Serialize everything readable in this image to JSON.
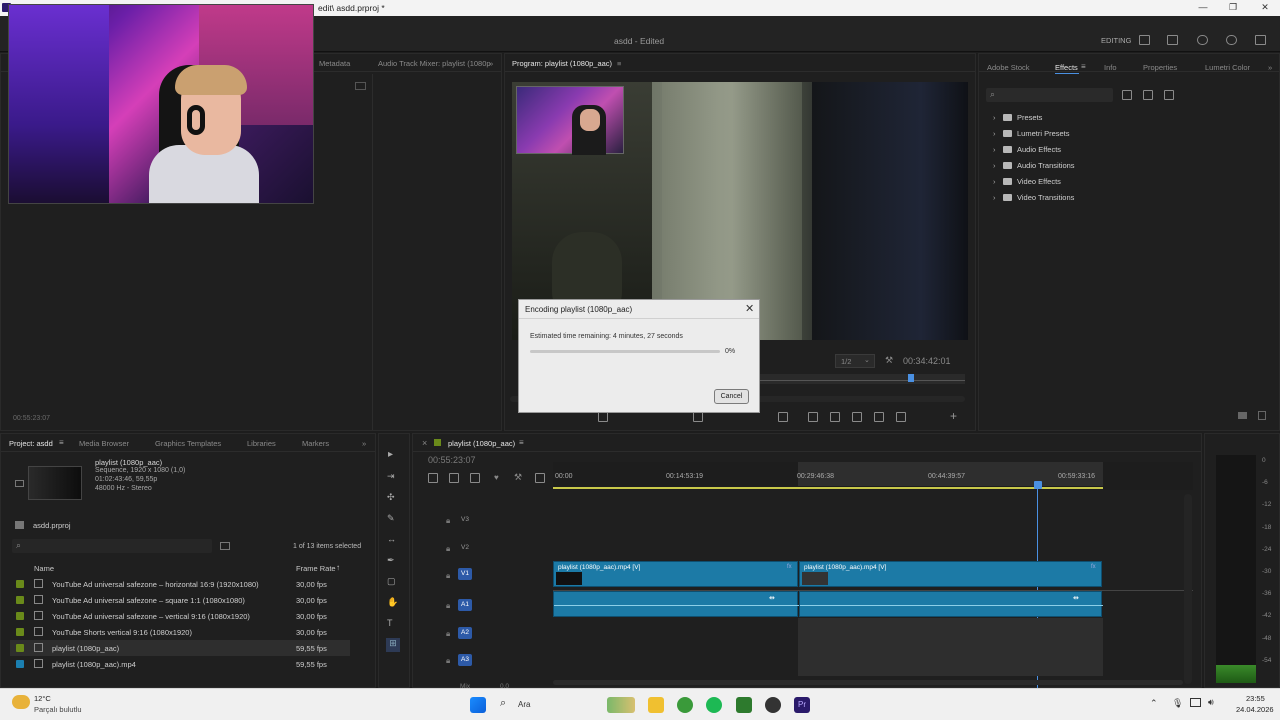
{
  "window": {
    "title": "edit\\ asdd.prproj *",
    "controls": [
      "—",
      "❐",
      "✕"
    ]
  },
  "header": {
    "project_status": "asdd - Edited",
    "mode": "EDITING"
  },
  "source_panel": {
    "tabs": [
      "Metadata",
      "Audio Track Mixer: playlist (1080p",
      "»"
    ],
    "timecode": "00:55:23:07"
  },
  "program": {
    "tab": "Program: playlist (1080p_aac)",
    "tab_menu": "≡",
    "zoom": "1/2",
    "duration": "00:34:42:01"
  },
  "effects_panel": {
    "tabs": [
      "Adobe Stock",
      "Effects",
      "Info",
      "Properties",
      "Lumetri Color",
      "»"
    ],
    "active_tab": "Effects",
    "items": [
      "Presets",
      "Lumetri Presets",
      "Audio Effects",
      "Audio Transitions",
      "Video Effects",
      "Video Transitions"
    ]
  },
  "dialog": {
    "title": "Encoding playlist (1080p_aac)",
    "close": "✕",
    "estimate": "Estimated time remaining: 4 minutes, 27 seconds",
    "progress_pct": 0,
    "progress_label": "0%",
    "cancel": "Cancel"
  },
  "project_panel": {
    "tabs": [
      "Project: asdd",
      "Media Browser",
      "Graphics Templates",
      "Libraries",
      "Markers",
      "»"
    ],
    "seq_name": "playlist (1080p_aac)",
    "seq_info1": "Sequence, 1920 x 1080 (1,0)",
    "seq_info2": "01:02:43:46, 59,55p",
    "seq_info3": "48000 Hz - Stereo",
    "file": "asdd.prproj",
    "selection": "1 of 13 items selected",
    "col_name": "Name",
    "col_rate": "Frame Rate",
    "sort_arrow": "↑",
    "rows": [
      {
        "name": "YouTube Ad universal safezone – horizontal 16:9 (1920x1080)",
        "rate": "30,00 fps",
        "color": "#6a8a1a"
      },
      {
        "name": "YouTube Ad universal safezone – square 1:1 (1080x1080)",
        "rate": "30,00 fps",
        "color": "#6a8a1a"
      },
      {
        "name": "YouTube Ad universal safezone – vertical 9:16 (1080x1920)",
        "rate": "30,00 fps",
        "color": "#6a8a1a"
      },
      {
        "name": "YouTube Shorts vertical 9:16 (1080x1920)",
        "rate": "30,00 fps",
        "color": "#6a8a1a"
      },
      {
        "name": "playlist (1080p_aac)",
        "rate": "59,55 fps",
        "color": "#6a8a1a"
      },
      {
        "name": "playlist (1080p_aac).mp4",
        "rate": "59,55 fps",
        "color": "#1b7fb0"
      }
    ]
  },
  "timeline": {
    "tab": "playlist (1080p_aac)",
    "tab_menu": "≡",
    "timecode": "00:55:23:07",
    "ruler": [
      "00:00",
      "00:14:53:19",
      "00:29:46:38",
      "00:44:39:57",
      "00:59:33:16"
    ],
    "video_tracks": [
      "V3",
      "V2",
      "V1"
    ],
    "audio_tracks": [
      "A1",
      "A2",
      "A3"
    ],
    "clip_label": "playlist (1080p_aac).mp4 [V]",
    "fx_badge": "fx",
    "mix_label": "Mix",
    "mix_value": "0,0"
  },
  "meter": {
    "labels": [
      "0",
      "-6",
      "-12",
      "-18",
      "-24",
      "-30",
      "-36",
      "-42",
      "-48",
      "-54"
    ]
  },
  "taskbar": {
    "weather_temp": "12°C",
    "weather_desc": "Parçalı bulutlu",
    "search": "Ara",
    "time": "23:55",
    "date": "24.04.2026"
  }
}
